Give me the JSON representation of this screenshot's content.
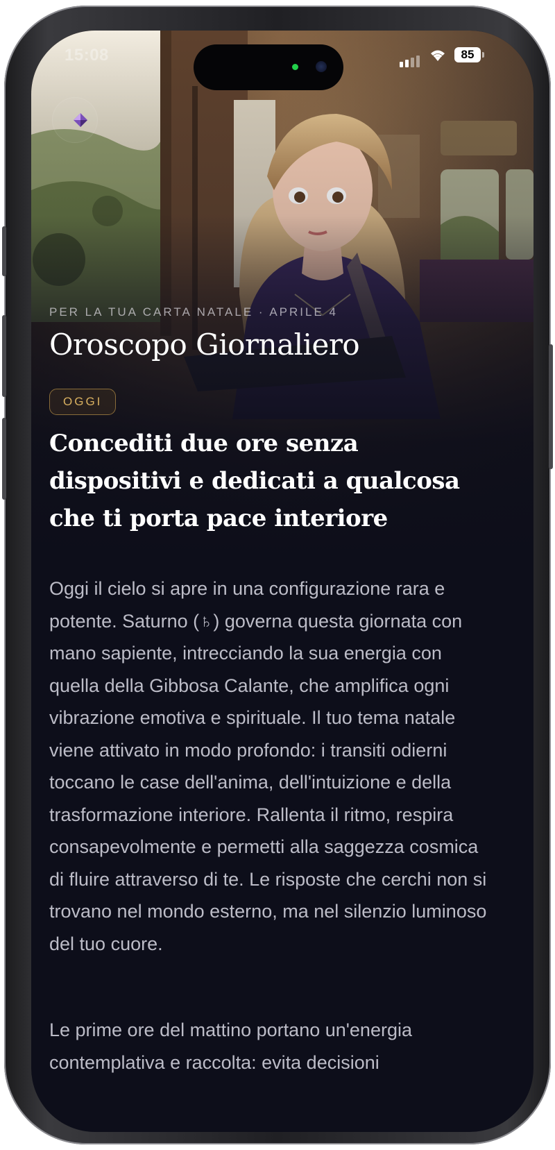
{
  "status_bar": {
    "time": "15:08",
    "battery": "85"
  },
  "hero": {
    "eyebrow": "PER LA TUA CARTA NATALE · APRILE 4",
    "title": "Oroscopo Giornaliero"
  },
  "badge": {
    "label": "OGGI"
  },
  "headline": "Concediti due ore senza dispositivi e dedicati a qualcosa che ti porta pace interiore",
  "body": {
    "paragraph_1": "Oggi il cielo si apre in una configurazione rara e potente. Saturno (♄) governa questa giornata con mano sapiente, intrecciando la sua energia con quella della Gibbosa Calante, che amplifica ogni vibrazione emotiva e spirituale. Il tuo tema natale viene attivato in modo profondo: i transiti odierni toccano le case dell'anima, dell'intuizione e della trasformazione interiore. Rallenta il ritmo, respira consapevolmente e permetti alla saggezza cosmica di fluire attraverso di te. Le risposte che cerchi non si trovano nel mondo esterno, ma nel silenzio luminoso del tuo cuore.",
    "paragraph_2": "Le prime ore del mattino portano un'energia contemplativa e raccolta: evita decisioni"
  },
  "colors": {
    "background": "#0d0e1a",
    "accent_gold": "#d8b060",
    "body_text": "#bcbcc7"
  },
  "icons": [
    "app-gem-icon",
    "cellular-signal-icon",
    "wifi-icon",
    "battery-icon"
  ]
}
